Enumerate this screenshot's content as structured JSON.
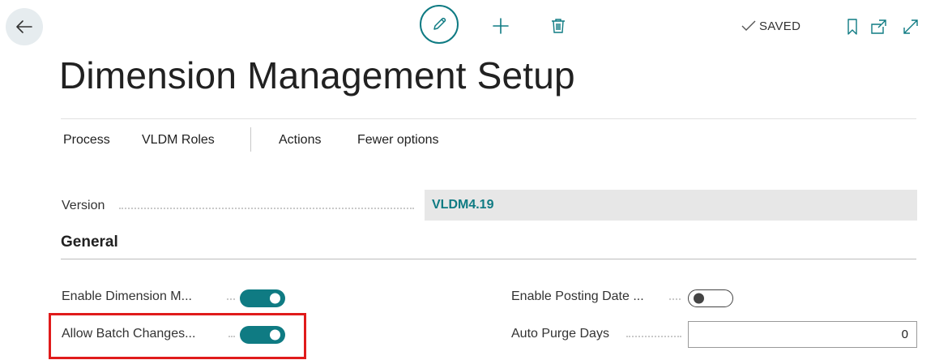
{
  "header": {
    "status": "SAVED",
    "icons": {
      "back": "back-arrow-icon",
      "edit": "pencil-icon",
      "new": "plus-icon",
      "delete": "trash-icon",
      "saved": "checkmark-icon",
      "bookmark": "bookmark-icon",
      "open_new_window": "open-new-window-icon",
      "expand": "expand-icon"
    },
    "accent_color": "#0f7b83"
  },
  "page": {
    "title": "Dimension Management Setup"
  },
  "action_bar": {
    "items": [
      "Process",
      "VLDM Roles",
      "Actions",
      "Fewer options"
    ]
  },
  "version": {
    "label": "Version",
    "value": "VLDM4.19"
  },
  "general": {
    "title": "General",
    "enable_dimension": {
      "label": "Enable Dimension M...",
      "checked": true
    },
    "allow_batch_changes": {
      "label": "Allow Batch Changes...",
      "checked": true
    },
    "enable_posting_date": {
      "label": "Enable Posting Date ...",
      "checked": false
    },
    "auto_purge_days": {
      "label": "Auto Purge Days",
      "value": "0"
    }
  },
  "highlight_color": "#e01b1b"
}
